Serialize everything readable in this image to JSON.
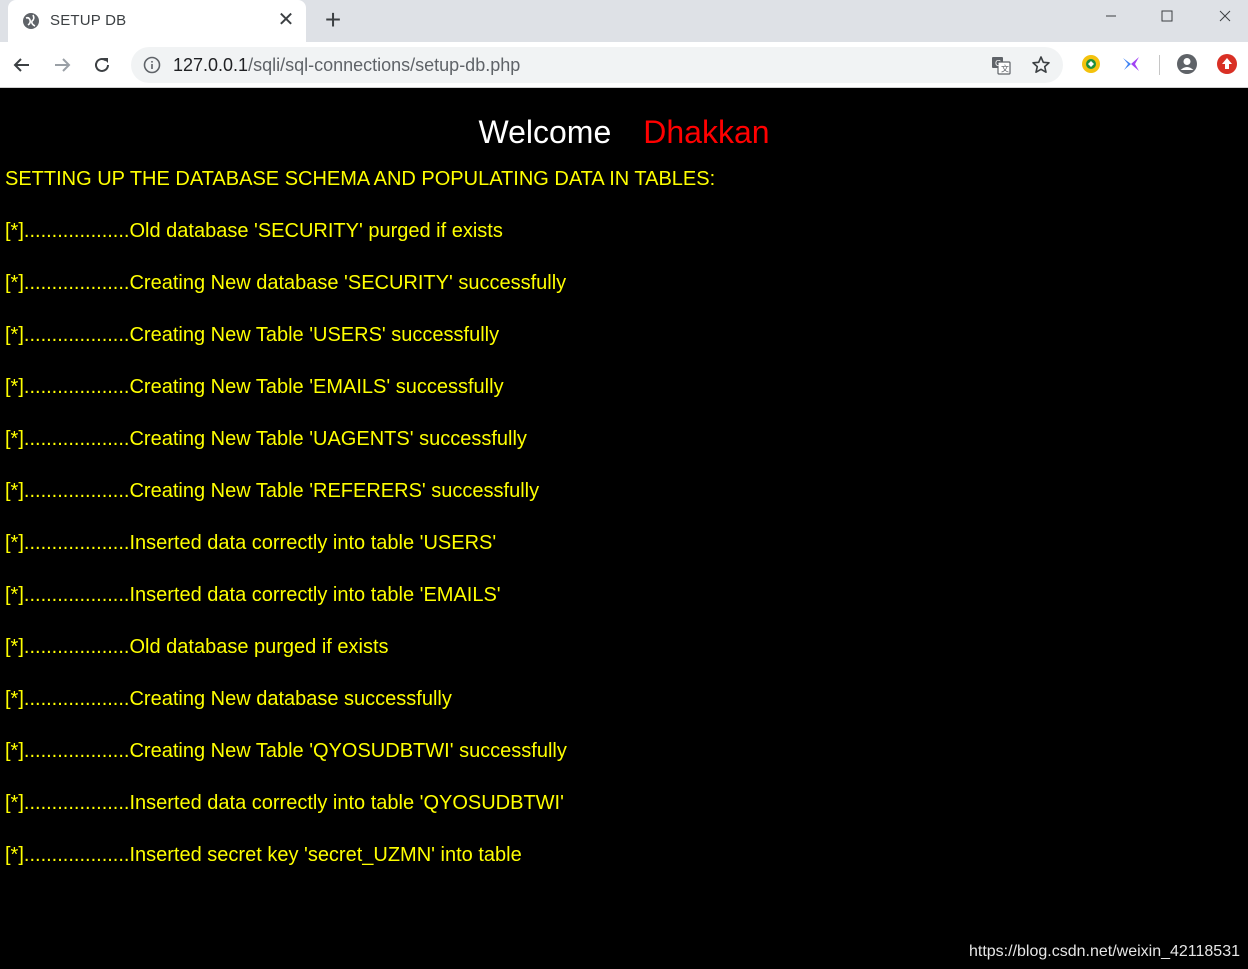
{
  "browser": {
    "tab": {
      "title": "SETUP DB",
      "close": "✕"
    },
    "new_tab": "+",
    "address": {
      "host": "127.0.0.1",
      "path": "/sqli/sql-connections/setup-db.php"
    }
  },
  "page": {
    "welcome": "Welcome",
    "user": "Dhakkan",
    "heading": "SETTING UP THE DATABASE SCHEMA AND POPULATING DATA IN TABLES:",
    "log": [
      "[*]...................Old database 'SECURITY' purged if exists",
      "[*]...................Creating New database 'SECURITY' successfully",
      "[*]...................Creating New Table 'USERS' successfully",
      "[*]...................Creating New Table 'EMAILS' successfully",
      "[*]...................Creating New Table 'UAGENTS' successfully",
      "[*]...................Creating New Table 'REFERERS' successfully",
      "[*]...................Inserted data correctly into table 'USERS'",
      "[*]...................Inserted data correctly into table 'EMAILS'",
      "[*]...................Old database purged if exists",
      "[*]...................Creating New database successfully",
      "[*]...................Creating New Table 'QYOSUDBTWI' successfully",
      "[*]...................Inserted data correctly into table 'QYOSUDBTWI'",
      "[*]...................Inserted secret key 'secret_UZMN' into table"
    ],
    "watermark": "https://blog.csdn.net/weixin_42118531"
  },
  "colors": {
    "log_text": "#ffff00",
    "user_name": "#ff0000",
    "background": "#000000"
  }
}
